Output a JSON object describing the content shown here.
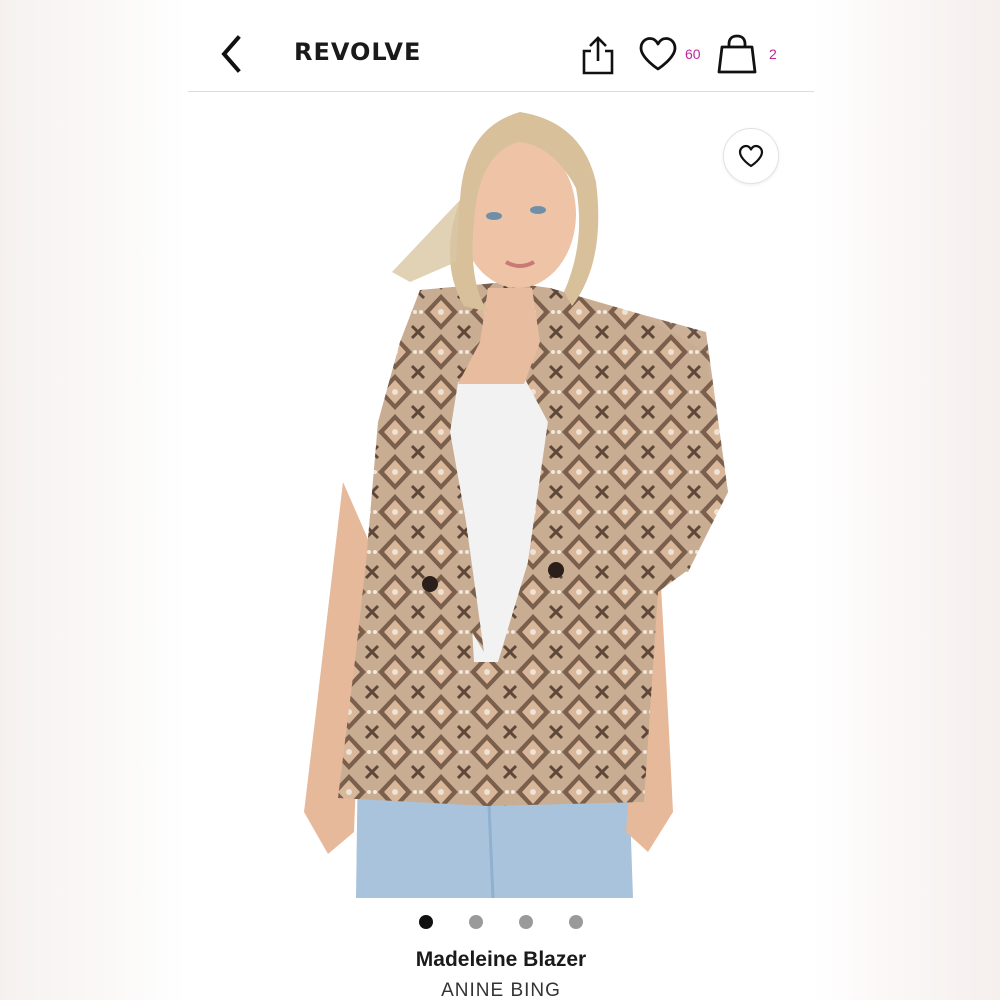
{
  "header": {
    "brand": "REVOLVE",
    "wishlist_count": "60",
    "bag_count": "2"
  },
  "icons": {
    "back": "chevron-left-icon",
    "share": "share-icon",
    "wishlist": "heart-icon",
    "bag": "shopping-bag-icon",
    "favorite": "heart-icon"
  },
  "colors": {
    "accent": "#c0249a",
    "text": "#1a1a1a",
    "dot_active": "#111111",
    "dot_inactive": "#9a9a9a"
  },
  "carousel": {
    "total": 4,
    "active_index": 0
  },
  "product": {
    "name": "Madeleine Blazer",
    "brand": "ANINE BING"
  }
}
